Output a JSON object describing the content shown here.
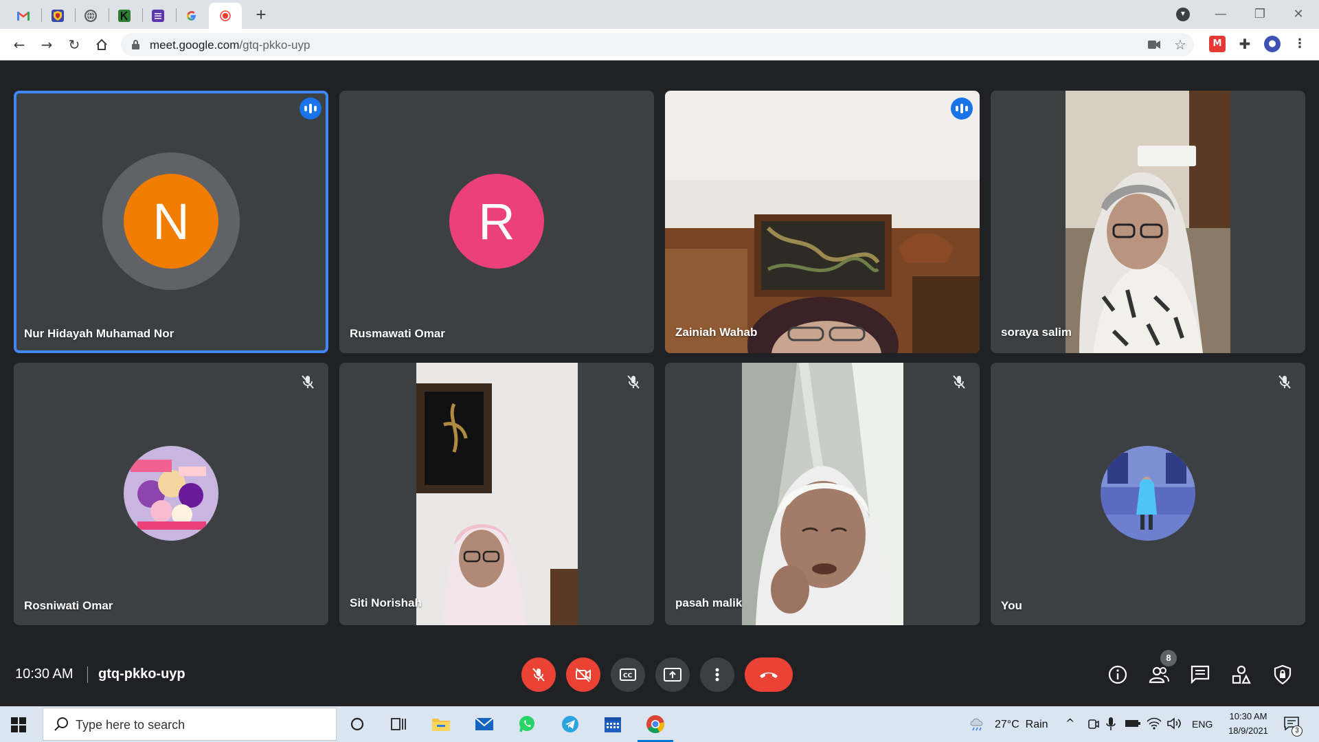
{
  "browser": {
    "url_host": "meet.google.com",
    "url_path": "/gtq-pkko-uyp",
    "tabs": [
      {
        "icon": "gmail-icon",
        "active": false
      },
      {
        "icon": "shield-favicon-icon",
        "active": false
      },
      {
        "icon": "globe-icon",
        "active": false
      },
      {
        "icon": "green-k-icon",
        "active": false
      },
      {
        "icon": "list-favicon-icon",
        "active": false
      },
      {
        "icon": "google-icon",
        "active": false
      },
      {
        "icon": "recording-icon",
        "active": true
      }
    ]
  },
  "participants": [
    {
      "name": "Nur Hidayah Muhamad Nor",
      "avatar_letter": "N",
      "avatar_color": "#f07c00",
      "speaking": true
    },
    {
      "name": "Rusmawati Omar",
      "avatar_letter": "R",
      "avatar_color": "#ec407a",
      "speaking": false
    },
    {
      "name": "Zainiah Wahab",
      "speaking": true,
      "video": true
    },
    {
      "name": "soraya salim",
      "video": true
    },
    {
      "name": "Rosniwati Omar",
      "muted": true,
      "photo_avatar": true
    },
    {
      "name": "Siti Norishah",
      "muted": true,
      "video": true
    },
    {
      "name": "pasah malik",
      "muted": true,
      "video": true
    },
    {
      "name": "You",
      "muted": true,
      "photo_avatar": true
    }
  ],
  "meet_bar": {
    "time": "10:30 AM",
    "meeting_code": "gtq-pkko-uyp",
    "people_count": "8"
  },
  "taskbar": {
    "search_placeholder": "Type here to search",
    "weather": "27°C  Rain",
    "language": "ENG",
    "clock_time": "10:30 AM",
    "clock_date": "18/9/2021",
    "notifications": "3"
  },
  "colors": {
    "meet_bg": "#202124",
    "tile_bg": "#3c4043",
    "accent_blue": "#1a73e8",
    "end_call_red": "#ea4335"
  }
}
